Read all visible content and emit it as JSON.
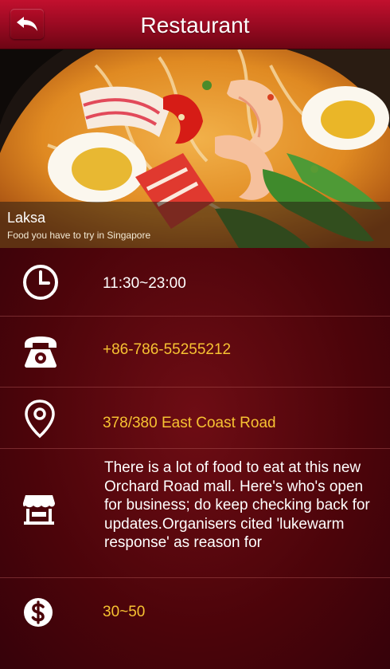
{
  "header": {
    "title": "Restaurant",
    "back_icon": "back-arrow-icon"
  },
  "hero": {
    "name": "Laksa",
    "tagline": "Food you have to try in Singapore"
  },
  "details": {
    "hours": {
      "icon": "clock-icon",
      "text": "11:30~23:00"
    },
    "phone": {
      "icon": "phone-icon",
      "text": "+86-786-55255212"
    },
    "address": {
      "icon": "location-pin-icon",
      "text": "378/380 East Coast Road"
    },
    "description": {
      "icon": "storefront-icon",
      "text": "There is a lot of food to eat at this new Orchard Road mall. Here's who's open for business; do keep checking back for updates.Organisers cited 'lukewarm response' as reason for"
    },
    "price": {
      "icon": "dollar-icon",
      "text": "30~50"
    }
  },
  "colors": {
    "header": "#a80c26",
    "background": "#4a0208",
    "accent_text": "#f7c232"
  }
}
